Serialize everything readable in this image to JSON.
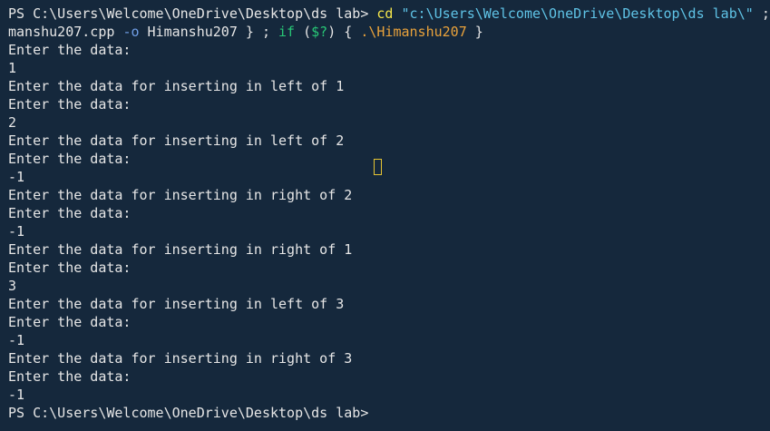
{
  "terminal": {
    "colors": {
      "background": "#15283c",
      "text": "#e6e6e6",
      "command": "#f4e54b",
      "string": "#5fc3e6",
      "flag": "#6f9de4",
      "keyword": "#28c776",
      "path": "#e9a23b",
      "cursor": "#e6c533"
    },
    "command_line": {
      "prompt": "PS C:\\Users\\Welcome\\OneDrive\\Desktop\\ds lab> ",
      "cmd": "cd",
      "space1": " ",
      "path_string": "\"c:\\Users\\Welcome\\OneDrive\\Desktop\\ds lab\\\"",
      "tail": " ;"
    },
    "command_line_cont": {
      "file": "manshu207.cpp ",
      "flag": "-o",
      "output": " Himanshu207 } ; ",
      "kw_if": "if",
      "paren_open": " (",
      "var": "$?",
      "paren_close": ") { ",
      "exe": ".\\Himanshu207",
      "close": " }"
    },
    "output_lines": [
      "Enter the data:",
      "1",
      "Enter the data for inserting in left of 1",
      "Enter the data:",
      "2",
      "Enter the data for inserting in left of 2",
      "Enter the data:",
      "-1",
      "Enter the data for inserting in right of 2",
      "Enter the data:",
      "-1",
      "Enter the data for inserting in right of 1",
      "Enter the data:",
      "3",
      "Enter the data for inserting in left of 3",
      "Enter the data:",
      "-1",
      "Enter the data for inserting in right of 3",
      "Enter the data:",
      "-1"
    ],
    "final_prompt": "PS C:\\Users\\Welcome\\OneDrive\\Desktop\\ds lab>"
  }
}
